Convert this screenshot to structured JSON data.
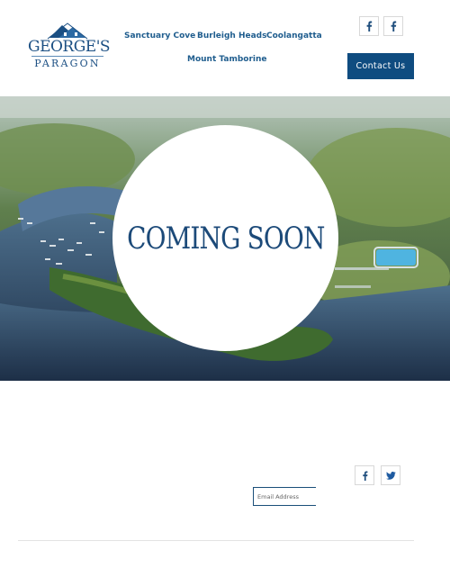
{
  "brand": {
    "name_line1": "GEORGE'S",
    "name_line2": "PARAGON"
  },
  "nav": {
    "items": [
      {
        "label": "Sanctuary Cove"
      },
      {
        "label": "Burleigh Heads"
      },
      {
        "label": "Coolangatta"
      },
      {
        "label": "Mount Tamborine"
      }
    ]
  },
  "header": {
    "contact_label": "Contact Us",
    "social": [
      "facebook-icon",
      "facebook-icon"
    ]
  },
  "hero": {
    "heading": "COMING SOON"
  },
  "footer": {
    "email_placeholder": "Email Address",
    "social": [
      "facebook-icon",
      "twitter-icon"
    ]
  },
  "colors": {
    "brand_blue": "#0f4c80",
    "nav_text": "#1f5d8e",
    "heading": "#1c4a79"
  }
}
